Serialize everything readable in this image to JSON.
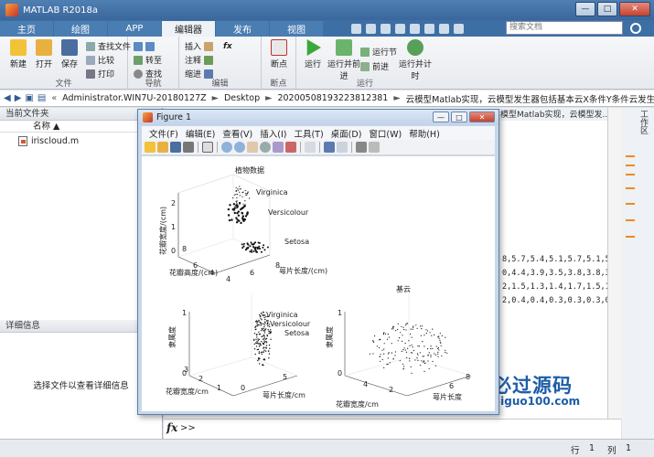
{
  "window": {
    "title": "MATLAB R2018a",
    "minimize": "—",
    "maximize": "□",
    "close": "✕"
  },
  "ribbon_tabs": [
    "主页",
    "绘图",
    "APP",
    "编辑器",
    "发布",
    "视图"
  ],
  "active_tab": "编辑器",
  "search": {
    "placeholder": "搜索文档"
  },
  "ribbon": {
    "file_group": {
      "label": "文件",
      "new": "新建",
      "open": "打开",
      "save": "保存",
      "find_files": "查找文件",
      "compare": "比较",
      "print": "打印"
    },
    "nav_group": {
      "label": "导航",
      "goto": "转至",
      "find": "查找"
    },
    "edit_group": {
      "label": "编辑",
      "insert": "插入",
      "comment": "注释",
      "indent": "缩进",
      "fx": "fx"
    },
    "breakpoint_group": {
      "label": "断点",
      "breakpoint": "断点"
    },
    "run_group": {
      "label": "运行",
      "run": "运行",
      "run_and_advance": "运行并前进",
      "run_section": "运行节",
      "advance": "前进",
      "run_and_time": "运行并计时"
    }
  },
  "address": {
    "segments": [
      "Administrator.WIN7U-20180127Z",
      "Desktop",
      "20200508193223812381",
      "云模型Matlab实现，云模型发生器包括基本云X条件Y条件云发生器"
    ],
    "separator": "►",
    "prefix": "«"
  },
  "current_folder": {
    "title": "当前文件夹",
    "column_name": "名称 ▲",
    "files": [
      "iriscloud.m"
    ]
  },
  "details": {
    "title": "详细信息",
    "message": "选择文件以查看详细信息"
  },
  "editor": {
    "tab_title": "模型Matlab实现，云模型发...",
    "lines": [
      "8,5.7,5.4,5.1,5.7,5.1,5.4",
      "0,4.4,3.9,3.5,3.8,3.8,3.4",
      "2,1.5,1.3,1.4,1.7,1.5,1.7",
      "2,0.4,0.4,0.3,0.3,0.3,0.2"
    ]
  },
  "workspace_label": "工作区",
  "command": {
    "fx": "fx",
    "prompt": ">>"
  },
  "status": {
    "row_label": "行",
    "row": "1",
    "col_label": "列",
    "col": "1"
  },
  "watermark": {
    "brand": "必过源码",
    "site": "Biguo100.com"
  },
  "figure": {
    "title": "Figure 1",
    "menus": [
      "文件(F)",
      "编辑(E)",
      "查看(V)",
      "插入(I)",
      "工具(T)",
      "桌面(D)",
      "窗口(W)",
      "帮助(H)"
    ],
    "plots": [
      {
        "title": "植物数据",
        "xlabel": "萼片长度/(cm)",
        "ylabel": "花瓣高度/(cm)",
        "zlabel": "花瓣宽度/(cm)",
        "labels": [
          "Virginica",
          "Versicolour",
          "Setosa"
        ],
        "xticks": [
          "4",
          "6",
          "8"
        ],
        "yticks": [
          "4",
          "6",
          "8"
        ],
        "zticks": [
          "0",
          "1",
          "2"
        ]
      },
      {
        "title": "",
        "xlabel": "萼片长度/cm",
        "ylabel": "花瓣宽度/cm",
        "zlabel": "隶属度",
        "labels": [
          "Virginica",
          "Versicolour",
          "Setosa"
        ],
        "xticks": [
          "0",
          "5"
        ],
        "yticks": [
          "1",
          "2",
          "3"
        ],
        "zticks": [
          "0",
          "1"
        ]
      },
      {
        "title": "基云",
        "xlabel": "萼片长度",
        "ylabel": "花瓣宽度/cm",
        "zlabel": "隶属度",
        "xticks": [
          "6",
          "8"
        ],
        "yticks": [
          "2",
          "4"
        ],
        "zticks": [
          "0",
          "1"
        ]
      }
    ]
  }
}
